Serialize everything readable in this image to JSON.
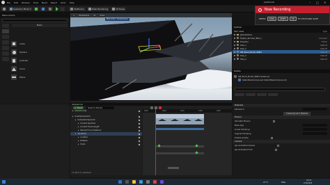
{
  "menu": {
    "items": [
      "File",
      "Edit",
      "Window",
      "Tools",
      "Build",
      "Select",
      "Actor",
      "Help"
    ],
    "app_title": "JapPlaneR"
  },
  "toolbar": {
    "mode_label": "Selection Mode",
    "platforms_label": "Platforms",
    "shell_label": "Shell Rendering",
    "vp_label": "VP Roles"
  },
  "place": {
    "title": "Place Actors",
    "category_tab": "Basic",
    "shapes": [
      {
        "label": "Cube"
      },
      {
        "label": "Sphere"
      },
      {
        "label": "Cylinder"
      },
      {
        "label": "Cone"
      },
      {
        "label": "Plane"
      }
    ]
  },
  "viewport": {
    "bar_items": [
      "Perspective",
      "Lit",
      "Show"
    ],
    "pilot_tag": "Pilot Actor: CineCamera"
  },
  "recording": {
    "title": "Now Recording",
    "press": "PRESS",
    "key1": "CTRL",
    "key2": "SHIFT",
    "key3": "F2",
    "hint": "TO STOP AND SAVE"
  },
  "outliner": {
    "title": "Outliner",
    "column_label": "Item Label",
    "column_type": "Type",
    "rows": [
      {
        "label": "JetsInterface",
        "type": "",
        "selected": false
      },
      {
        "label": "Fighter_Bomber_BSS_1",
        "type": "CineCam",
        "selected": false
      },
      {
        "label": "Propeller",
        "type": "Folder",
        "selected": false
      },
      {
        "label": "Tails_1",
        "type": "StaticM",
        "selected": false
      },
      {
        "label": "Tails_2",
        "type": "StaticM",
        "selected": false
      },
      {
        "label": "SM_Wood_Bomb_SM04",
        "type": "StaticM",
        "selected": true
      },
      {
        "label": "Tails_3",
        "type": "StaticM",
        "selected": false
      },
      {
        "label": "Tails_4",
        "type": "StaticM",
        "selected": false
      }
    ]
  },
  "details": {
    "title": "Details",
    "actor": "SM_Wood_Bomb_SM04 (Instance)",
    "component": "StaticMeshComponent (StaticMeshComponent)"
  },
  "sequencer": {
    "title": "Sequencer",
    "track_label": "+ Track",
    "search_placeholder": "Search Tracks",
    "tracks": [
      {
        "label": "Camera Cuts",
        "selected": false
      },
      {
        "label": "CineCameraActor",
        "selected": false
      },
      {
        "label": "CameraComponent",
        "selected": false
      },
      {
        "label": "Current Aperture",
        "selected": false
      },
      {
        "label": "Current Focal Length",
        "selected": false
      },
      {
        "label": "Manual Focus Distance",
        "selected": false
      },
      {
        "label": "Transform",
        "selected": true
      },
      {
        "label": "Location",
        "selected": false
      },
      {
        "label": "Rotation",
        "selected": false
      },
      {
        "label": "Scale",
        "selected": false
      }
    ],
    "item_count": "11 items (1 selected)",
    "ruler_ticks": [
      "0000",
      "0060",
      "0120",
      "0180",
      "0240"
    ]
  },
  "props": {
    "sections": [
      {
        "head": "Materials",
        "rows": [
          "Element 0"
        ]
      },
      {
        "head": "Physics",
        "rows": [
          "Simulate Physics",
          "Mass (kg)",
          "Linear Damping",
          "Angular Damping",
          "Enable Gravity"
        ]
      },
      {
        "head": "Collision",
        "rows": [
          "Ignore Radial Impulse",
          "Ignore Radial Force"
        ]
      }
    ],
    "button": "Create Dynamic Material"
  },
  "taskbar": {
    "time": "18:57",
    "date": "2/15/2025",
    "temp": "27°C",
    "lang": "ENG"
  },
  "colors": {
    "recording_red": "#c6202f",
    "selection_blue": "#2c5a8a",
    "playhead_red": "#e2233a",
    "key_green": "#51c45d"
  }
}
